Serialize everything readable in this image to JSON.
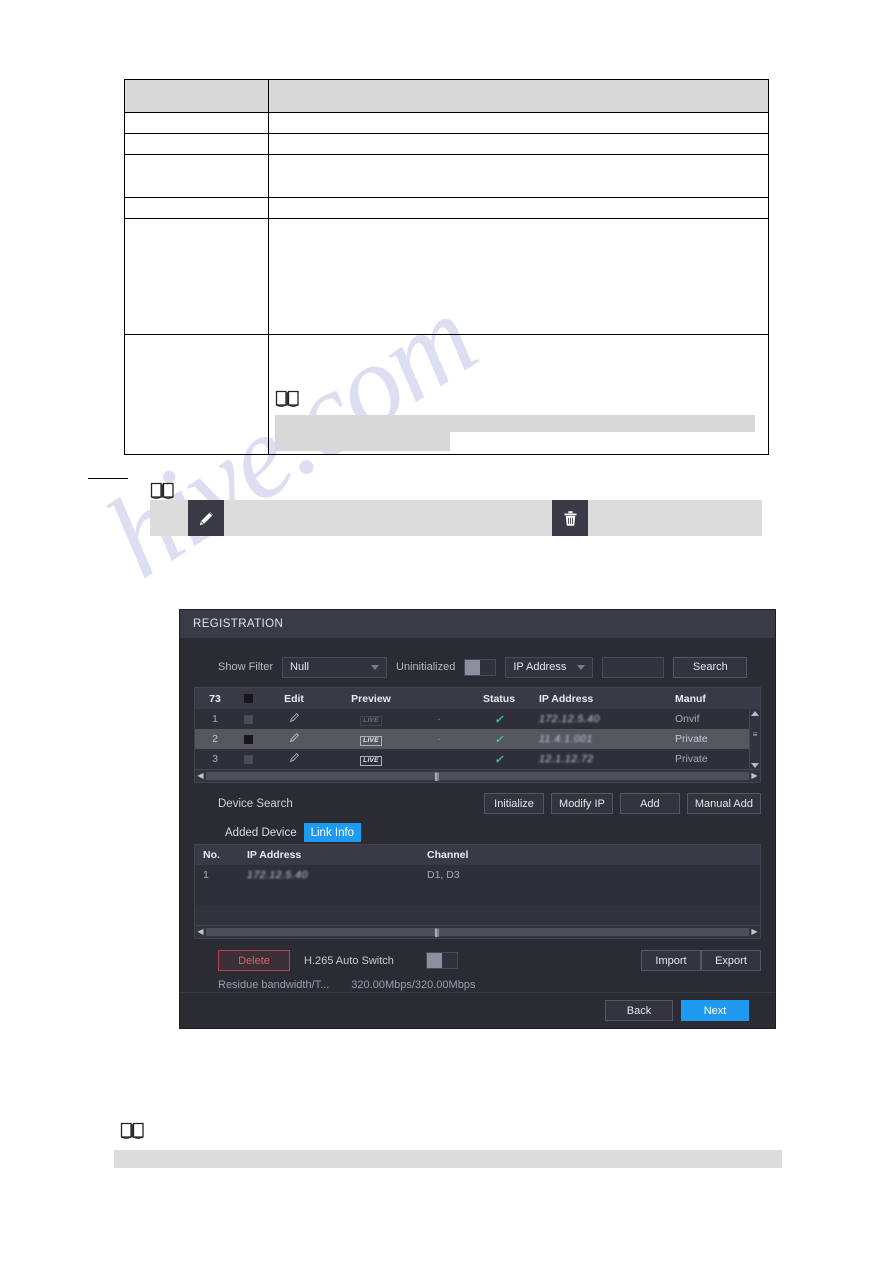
{
  "document": {
    "spec_table": {
      "header": [
        "",
        ""
      ],
      "rows": [
        {
          "label": "",
          "value": ""
        },
        {
          "label": "",
          "value": ""
        },
        {
          "label": "",
          "value": ""
        },
        {
          "label": "",
          "value": ""
        },
        {
          "label": "",
          "value": ""
        },
        {
          "label": "",
          "value": "",
          "note_icon": "note-book-icon"
        }
      ]
    },
    "mid_note": {
      "note_icon": "note-book-icon",
      "edit_icon": "pencil-icon",
      "delete_icon": "trash-icon"
    },
    "bottom_note": {
      "note_icon": "note-book-icon"
    },
    "watermark_text": "hive.com"
  },
  "dialog": {
    "title": "REGISTRATION",
    "filter": {
      "show_filter_label": "Show Filter",
      "show_filter_value": "Null",
      "uninitialized_label": "Uninitialized",
      "uninitialized_toggle": "off",
      "search_type_value": "IP Address",
      "search_input_value": "",
      "search_button": "Search"
    },
    "device_table": {
      "headers": {
        "count": "73",
        "checkbox": "",
        "edit": "Edit",
        "preview": "Preview",
        "dot": "",
        "status": "Status",
        "ip_address": "IP Address",
        "manufacturer": "Manuf"
      },
      "rows": [
        {
          "no": "1",
          "checked": false,
          "edit_icon": "pencil-icon",
          "preview": "LIVE",
          "preview_faded": true,
          "dot": "·",
          "status": "✓",
          "ip": "172.12.5.40",
          "manufacturer": "Onvif"
        },
        {
          "no": "2",
          "checked": true,
          "edit_icon": "pencil-icon",
          "preview": "LIVE",
          "preview_faded": false,
          "dot": "·",
          "status": "✓",
          "ip": "11.4.1.001",
          "manufacturer": "Private"
        },
        {
          "no": "3",
          "checked": false,
          "edit_icon": "pencil-icon",
          "preview": "LIVE",
          "preview_faded": false,
          "dot": "",
          "status": "✓",
          "ip": "12.1.12.72",
          "manufacturer": "Private"
        }
      ]
    },
    "actions": {
      "device_search_label": "Device Search",
      "initialize": "Initialize",
      "modify_ip": "Modify IP",
      "add": "Add",
      "manual_add": "Manual Add"
    },
    "tabs": [
      {
        "label": "Added Device",
        "active": false
      },
      {
        "label": "Link Info",
        "active": true
      }
    ],
    "added_table": {
      "headers": {
        "no": "No.",
        "ip_address": "IP Address",
        "channel": "Channel"
      },
      "rows": [
        {
          "no": "1",
          "ip": "172.12.5.40",
          "channel": "D1, D3"
        }
      ]
    },
    "bottom": {
      "delete": "Delete",
      "h265_label": "H.265 Auto Switch",
      "h265_toggle": "off",
      "import": "Import",
      "export": "Export",
      "residue_label": "Residue bandwidth/T...",
      "residue_value": "320.00Mbps/320.00Mbps"
    },
    "footer": {
      "back": "Back",
      "next": "Next"
    },
    "colors": {
      "accent": "#1e9bf0",
      "danger": "#e0606c",
      "status_ok": "#2ecc9a",
      "dialog_bg": "#2b2b33",
      "title_bg": "#3b3b47"
    }
  }
}
